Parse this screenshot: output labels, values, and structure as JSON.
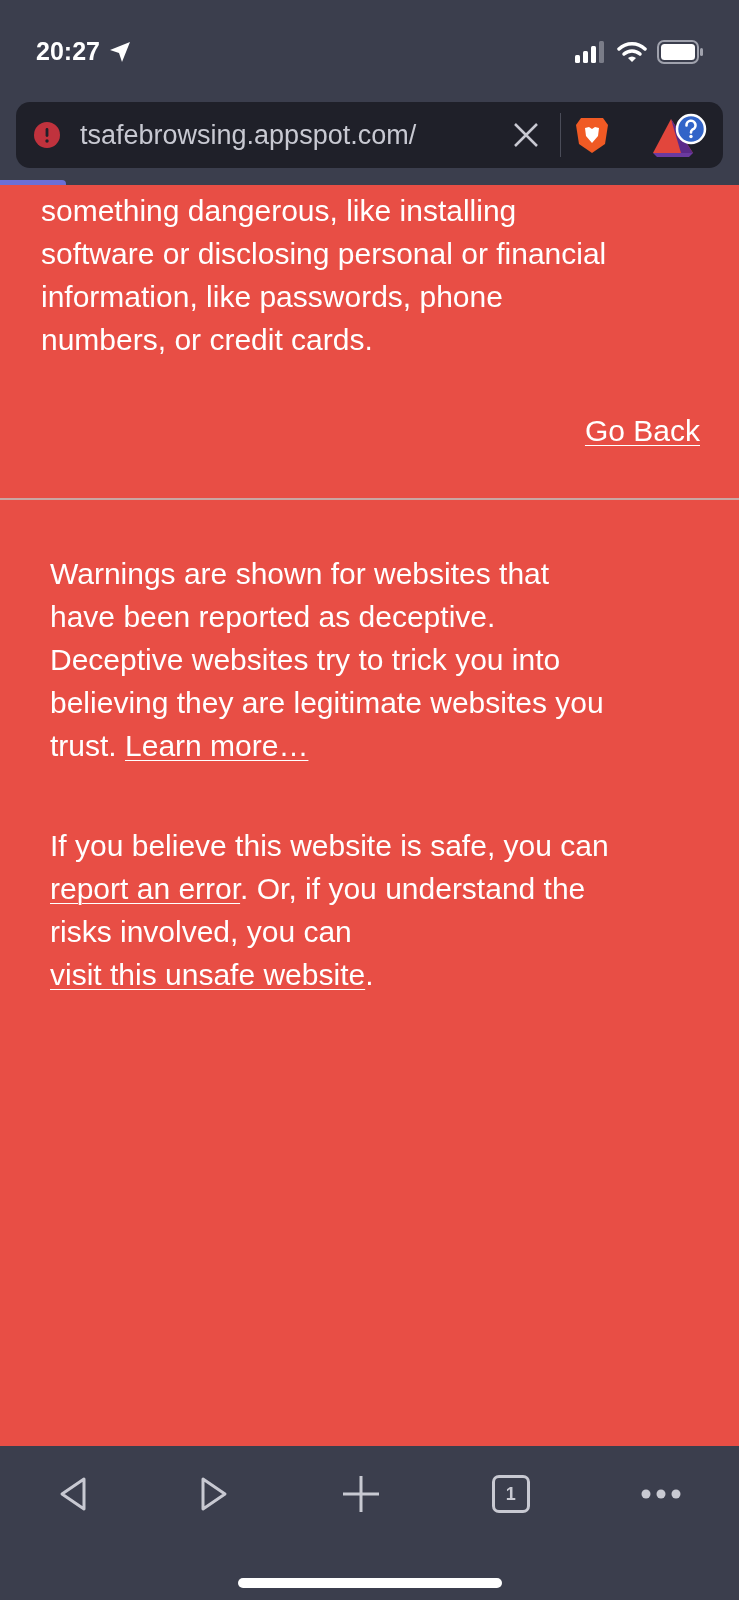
{
  "status_bar": {
    "time": "20:27"
  },
  "address_bar": {
    "url": "tsafebrowsing.appspot.com/"
  },
  "warning_top": {
    "lines": [
      "something dangerous, like installing",
      "software or disclosing personal or financial",
      "information, like passwords, phone",
      "numbers, or credit cards."
    ],
    "link": "Go Back"
  },
  "details": [
    [
      [
        {
          "kind": "text",
          "text": "Warnings are shown for websites that"
        }
      ],
      [
        {
          "kind": "text",
          "text": "have been reported as deceptive."
        }
      ],
      [
        {
          "kind": "text",
          "text": "Deceptive websites try to trick you into"
        }
      ],
      [
        {
          "kind": "text",
          "text": "believing they are legitimate websites you"
        }
      ],
      [
        {
          "kind": "text",
          "text": "trust. "
        },
        {
          "kind": "link",
          "text": "Learn more…"
        }
      ]
    ],
    [
      [
        {
          "kind": "text",
          "text": "If you believe this website is safe, you can"
        }
      ],
      [
        {
          "kind": "link",
          "text": "report an error"
        },
        {
          "kind": "text",
          "text": ". Or, if you understand the"
        }
      ],
      [
        {
          "kind": "text",
          "text": "risks involved, you can"
        }
      ],
      [
        {
          "kind": "link",
          "text": "visit this unsafe website"
        },
        {
          "kind": "text",
          "text": "."
        }
      ]
    ]
  ],
  "toolbar": {
    "tab_count": "1"
  }
}
